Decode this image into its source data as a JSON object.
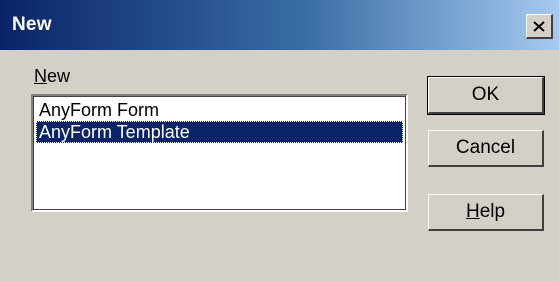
{
  "window": {
    "title": "New"
  },
  "list": {
    "label_accel": "N",
    "label_rest": "ew",
    "items": [
      {
        "label": "AnyForm Form",
        "selected": false
      },
      {
        "label": "AnyForm Template",
        "selected": true
      }
    ]
  },
  "buttons": {
    "ok": "OK",
    "cancel": "Cancel",
    "help_accel": "H",
    "help_rest": "elp"
  },
  "colors": {
    "title_gradient_start": "#0a246a",
    "title_gradient_end": "#a6caf0",
    "selection": "#0a246a",
    "face": "#d4d0c8"
  }
}
